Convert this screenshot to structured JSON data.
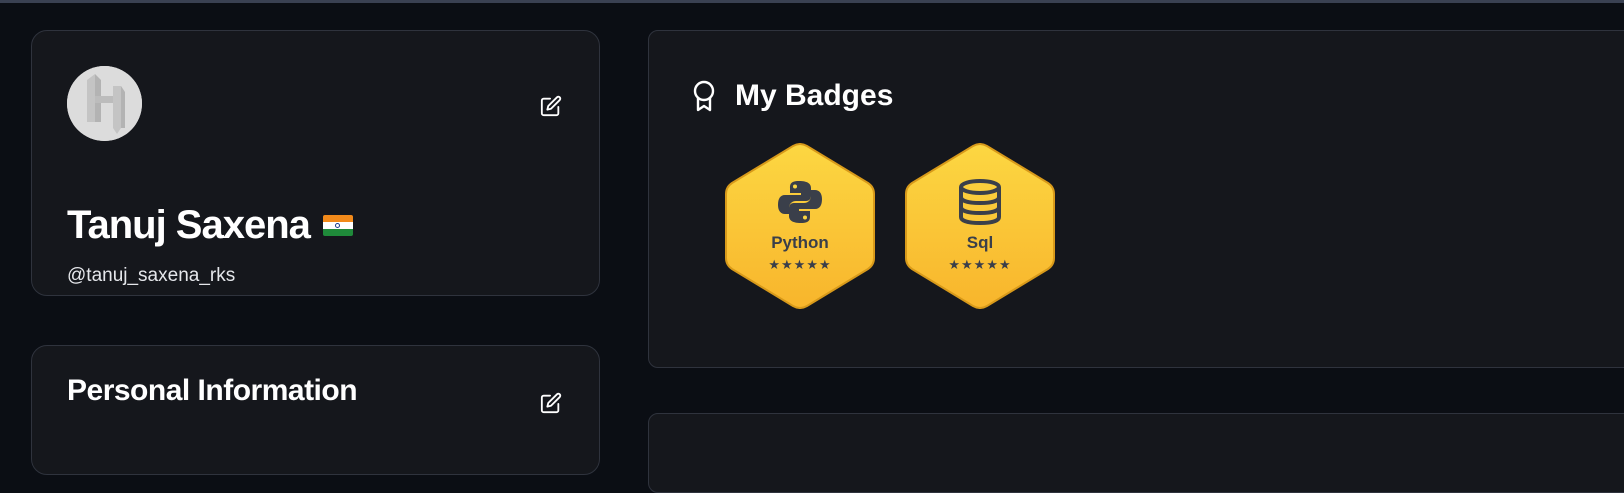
{
  "profile": {
    "name": "Tanuj Saxena",
    "username": "@tanuj_saxena_rks",
    "avatar_icon": "h-logo-avatar",
    "flag_icon": "india-flag-icon",
    "edit_icon": "edit-icon"
  },
  "personal_info": {
    "title": "Personal Information",
    "edit_icon": "edit-icon"
  },
  "badges": {
    "title": "My Badges",
    "icon": "badge-award-icon",
    "items": [
      {
        "label": "Python",
        "stars": "★★★★★",
        "icon": "python-icon",
        "rating": 5
      },
      {
        "label": "Sql",
        "stars": "★★★★★",
        "icon": "database-icon",
        "rating": 5
      }
    ]
  },
  "colors": {
    "background": "#0b0e14",
    "card": "#15171c",
    "card_border": "#2f333d",
    "badge_gold_top": "#fcd742",
    "badge_gold_bottom": "#f8b52c",
    "badge_text": "#3a3f4a"
  }
}
